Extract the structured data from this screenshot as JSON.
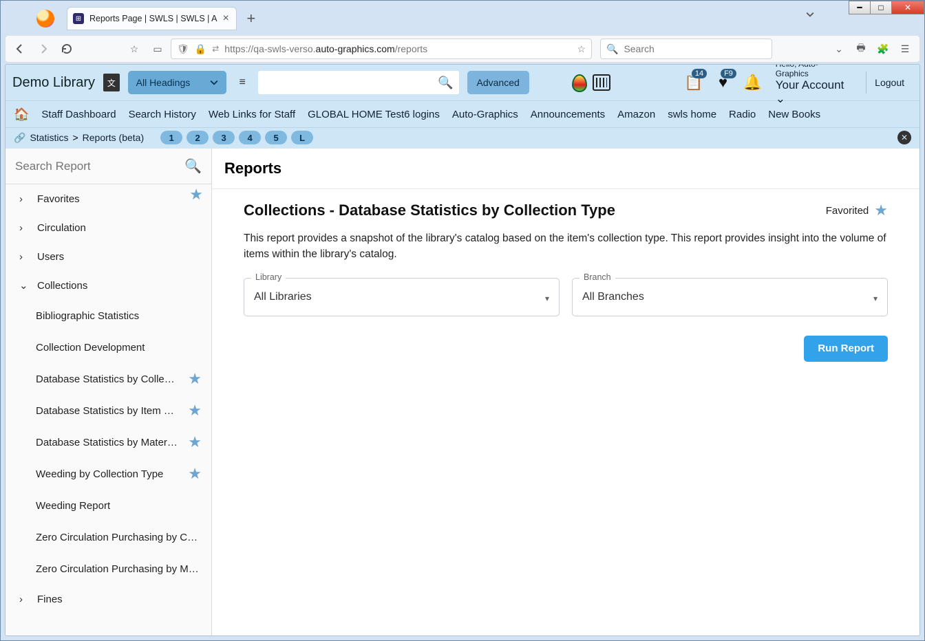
{
  "browser": {
    "tab_title": "Reports Page | SWLS | SWLS | A",
    "url_prefix": "https://qa-swls-verso.",
    "url_host": "auto-graphics.com",
    "url_path": "/reports",
    "search_placeholder": "Search"
  },
  "app": {
    "library_title": "Demo Library",
    "heading_select": "All Headings",
    "advanced": "Advanced",
    "hello": "Hello, Auto-Graphics",
    "account": "Your Account",
    "logout": "Logout",
    "badge_list": "14",
    "badge_fav": "F9",
    "nav": [
      "Staff Dashboard",
      "Search History",
      "Web Links for Staff",
      "GLOBAL HOME Test6 logins",
      "Auto-Graphics",
      "Announcements",
      "Amazon",
      "swls home",
      "Radio",
      "New Books"
    ],
    "crumb_a": "Statistics",
    "crumb_b": "Reports (beta)",
    "pills": [
      "1",
      "2",
      "3",
      "4",
      "5",
      "L"
    ]
  },
  "sidebar": {
    "search_placeholder": "Search Report",
    "groups": {
      "favorites": "Favorites",
      "circulation": "Circulation",
      "users": "Users",
      "collections": "Collections",
      "fines": "Fines"
    },
    "collections_items": [
      {
        "label": "Bibliographic Statistics",
        "fav": false
      },
      {
        "label": "Collection Development",
        "fav": false
      },
      {
        "label": "Database Statistics by Collection …",
        "fav": true
      },
      {
        "label": "Database Statistics by Item Except…",
        "fav": true
      },
      {
        "label": "Database Statistics by Material Ty…",
        "fav": true
      },
      {
        "label": "Weeding by Collection Type",
        "fav": true
      },
      {
        "label": "Weeding Report",
        "fav": false
      },
      {
        "label": "Zero Circulation Purchasing by Collect…",
        "fav": false
      },
      {
        "label": "Zero Circulation Purchasing by Materi…",
        "fav": false
      }
    ]
  },
  "main": {
    "heading": "Reports",
    "report_title": "Collections - Database Statistics by Collection Type",
    "favorited": "Favorited",
    "description": "This report provides a snapshot of the library's catalog based on the item's collection type. This report provides insight into the volume of items within the library's catalog.",
    "library_label": "Library",
    "library_value": "All Libraries",
    "branch_label": "Branch",
    "branch_value": "All Branches",
    "run": "Run Report"
  }
}
